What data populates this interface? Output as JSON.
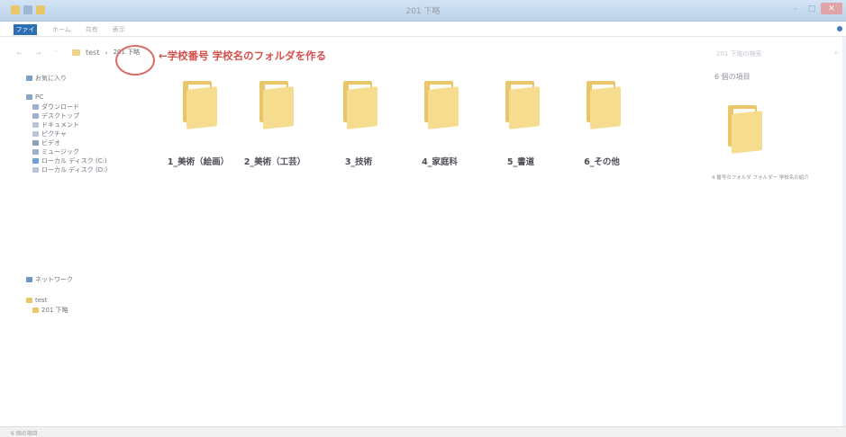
{
  "window": {
    "title": "201 下略"
  },
  "ribbon": {
    "file_tab": "ファイル",
    "tabs": [
      "ホーム",
      "共有",
      "表示"
    ]
  },
  "address": {
    "nav": "← → ˅ ↑",
    "path_test": "test",
    "path_current": "201 下略",
    "search_placeholder": "201 下略の検索"
  },
  "annotation": {
    "note": "←学校番号 学校名のフォルダを作る"
  },
  "sidebar": {
    "quick_access": "お気に入り",
    "pc": "PC",
    "pc_items": [
      "ダウンロード",
      "デスクトップ",
      "ドキュメント",
      "ピクチャ",
      "ビデオ",
      "ミュージック",
      "ローカル ディスク (C:)",
      "ローカル ディスク (D:)"
    ],
    "network": "ネットワーク",
    "test": "test",
    "sub_folder": "201 下略"
  },
  "folders": [
    "1_美術（絵画）",
    "2_美術（工芸）",
    "3_技術",
    "4_家庭科",
    "5_書道",
    "6_その他"
  ],
  "preview": {
    "title": "6 個の項目",
    "meta": "4 番号のフォルダ   フォルダー   学校名の紹介"
  },
  "status": {
    "text": "6 個の項目"
  },
  "colors": {
    "accent": "#2d6fb3",
    "annotation": "#d5504c",
    "folder": "#f6dc8e"
  }
}
